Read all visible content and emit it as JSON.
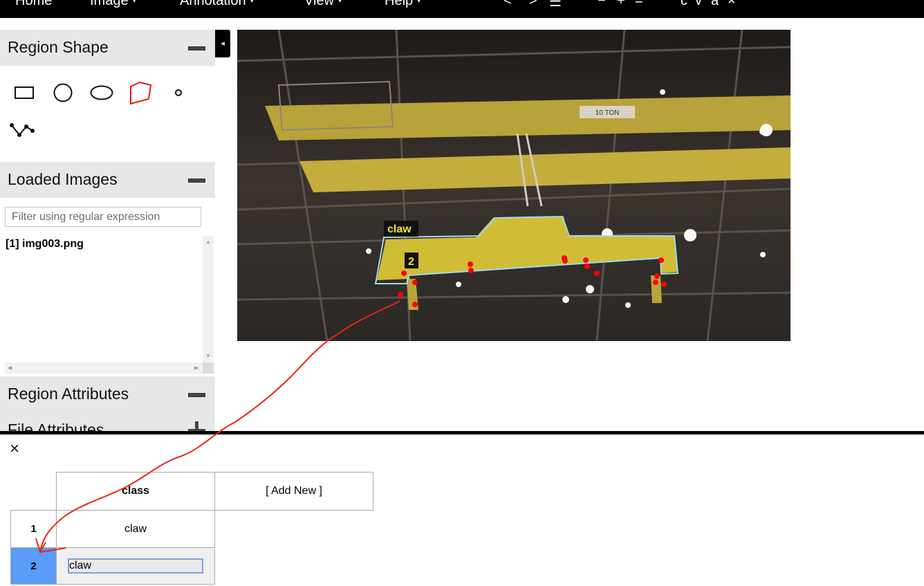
{
  "menubar": {
    "home": "Home",
    "image": "Image",
    "annotation": "Annotation",
    "view": "View",
    "help": "Help",
    "caret": "▾",
    "toolbar_glyphs": [
      "<",
      ">",
      "☰",
      "−",
      "+",
      "=",
      "c",
      "v",
      "a",
      "×"
    ]
  },
  "left_panel": {
    "region_shape": {
      "title": "Region Shape",
      "shapes": [
        "rectangle-icon",
        "circle-icon",
        "ellipse-icon",
        "polygon-icon",
        "point-icon",
        "polyline-icon"
      ],
      "selected_shape": "polygon-icon"
    },
    "loaded_images": {
      "title": "Loaded Images",
      "filter_placeholder": "Filter using regular expression",
      "items": [
        {
          "label": "[1] img003.png"
        }
      ]
    },
    "region_attributes": {
      "title": "Region Attributes"
    },
    "file_attributes": {
      "title": "File Attributes"
    },
    "collapse_glyph": "◂"
  },
  "canvas": {
    "region_labels": [
      "claw",
      "2"
    ],
    "sign_text": "10 TON",
    "colors": {
      "region_outline": "#9fd9f0",
      "vertex": "#ff0000",
      "label_bg": "#111111",
      "label_fg": "#f5e43a"
    }
  },
  "attribute_editor": {
    "close": "×",
    "column_header": "class",
    "add_new": "[ Add New ]",
    "rows": [
      {
        "index": "1",
        "class": "claw"
      },
      {
        "index": "2",
        "class": "claw"
      }
    ],
    "selected_row": "2",
    "colors": {
      "selected": "#5a9cf7"
    }
  }
}
